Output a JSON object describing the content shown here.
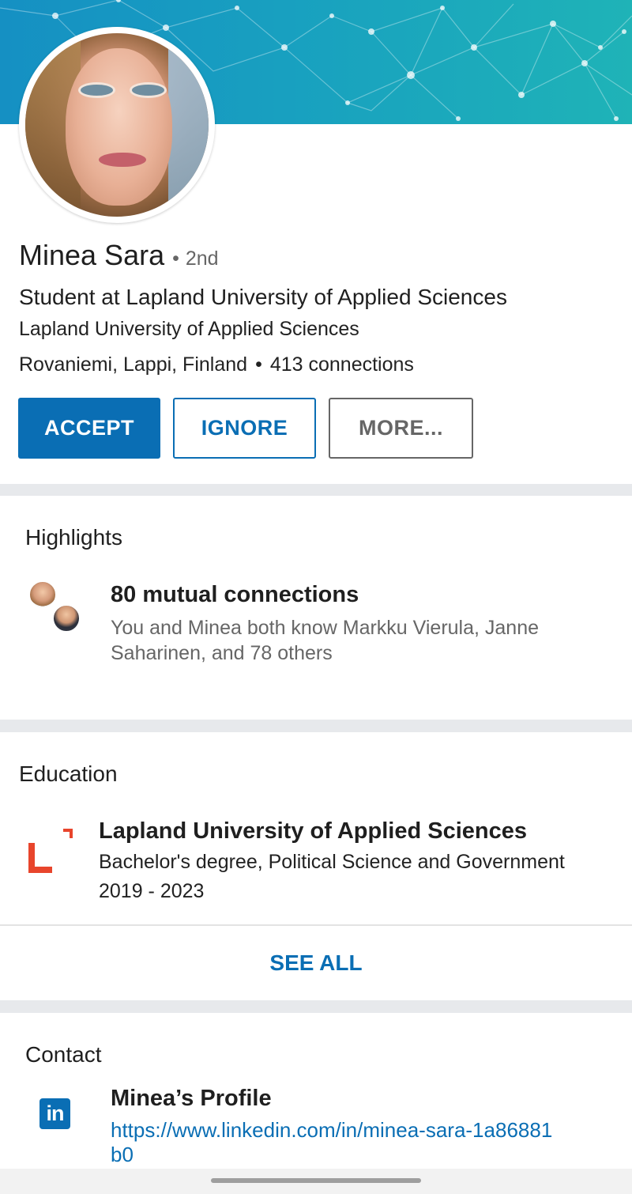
{
  "profile": {
    "name": "Minea Sara",
    "degree": "2nd",
    "headline": "Student at Lapland University of Applied Sciences",
    "school": "Lapland University of Applied Sciences",
    "location": "Rovaniemi, Lappi, Finland",
    "connections": "413 connections"
  },
  "actions": {
    "accept_label": "ACCEPT",
    "ignore_label": "IGNORE",
    "more_label": "MORE..."
  },
  "highlights": {
    "title": "Highlights",
    "mutual_title": "80 mutual connections",
    "mutual_desc": "You and Minea both know Markku Vierula, Janne Saharinen, and 78 others"
  },
  "education": {
    "title": "Education",
    "school": "Lapland University of Applied Sciences",
    "degree": "Bachelor's degree, Political Science and Government",
    "years": "2019 - 2023",
    "logo_letter": "L",
    "see_all_label": "SEE ALL"
  },
  "contact": {
    "title": "Contact",
    "profile_label": "Minea’s Profile",
    "profile_url": "https://www.linkedin.com/in/minea-sara-1a86881b0",
    "icon_text": "in"
  },
  "colors": {
    "accent": "#0a6eb4",
    "logo_red": "#e8452c",
    "section_gap": "#e7e9ec"
  },
  "icons": {
    "dot_separator": "•"
  }
}
